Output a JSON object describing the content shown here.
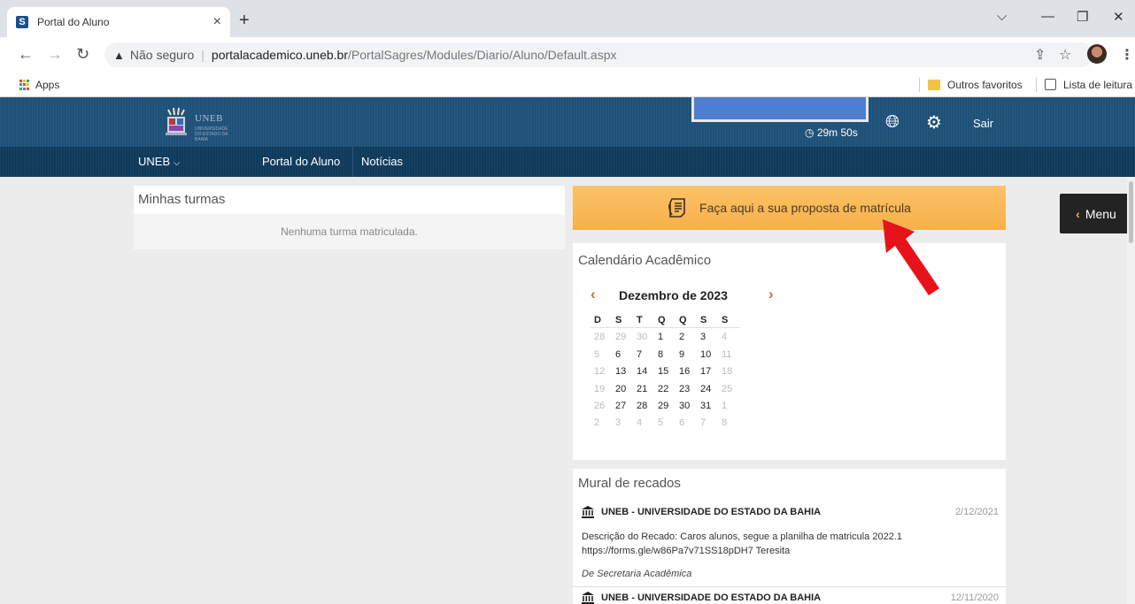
{
  "browser": {
    "tab_title": "Portal do Aluno",
    "tab_favicon_letter": "S",
    "tab_close": "×",
    "new_tab": "+",
    "url_insecure_label": "Não seguro",
    "url_host": "portalacademico.uneb.br",
    "url_path": "/PortalSagres/Modules/Diario/Aluno/Default.aspx",
    "bookmarks": {
      "apps": "Apps",
      "other": "Outros favoritos",
      "reading_list": "Lista de leitura"
    }
  },
  "header": {
    "logo_text": "UNEB",
    "logo_subtext": "UNIVERSIDADE DO ESTADO DA BAHIA",
    "timer": "29m 50s",
    "logout": "Sair"
  },
  "nav": {
    "uneb": "UNEB",
    "portal": "Portal do Aluno",
    "news": "Notícias"
  },
  "turmas": {
    "title": "Minhas turmas",
    "empty": "Nenhuma turma matriculada."
  },
  "proposta": {
    "label": "Faça aqui a sua proposta de matrícula"
  },
  "calendar": {
    "title": "Calendário Acadêmico",
    "month": "Dezembro de 2023",
    "prev": "‹",
    "next": "›",
    "weekdays": [
      "D",
      "S",
      "T",
      "Q",
      "Q",
      "S",
      "S"
    ],
    "weeks": [
      [
        {
          "d": "28",
          "m": "out"
        },
        {
          "d": "29",
          "m": "out"
        },
        {
          "d": "30",
          "m": "out"
        },
        {
          "d": "1",
          "m": "in"
        },
        {
          "d": "2",
          "m": "in"
        },
        {
          "d": "3",
          "m": "in"
        },
        {
          "d": "4",
          "m": "we"
        }
      ],
      [
        {
          "d": "5",
          "m": "we"
        },
        {
          "d": "6",
          "m": "in"
        },
        {
          "d": "7",
          "m": "in"
        },
        {
          "d": "8",
          "m": "in"
        },
        {
          "d": "9",
          "m": "in"
        },
        {
          "d": "10",
          "m": "in"
        },
        {
          "d": "11",
          "m": "we"
        }
      ],
      [
        {
          "d": "12",
          "m": "we"
        },
        {
          "d": "13",
          "m": "in"
        },
        {
          "d": "14",
          "m": "in"
        },
        {
          "d": "15",
          "m": "in"
        },
        {
          "d": "16",
          "m": "in"
        },
        {
          "d": "17",
          "m": "in"
        },
        {
          "d": "18",
          "m": "we"
        }
      ],
      [
        {
          "d": "19",
          "m": "we"
        },
        {
          "d": "20",
          "m": "in"
        },
        {
          "d": "21",
          "m": "in"
        },
        {
          "d": "22",
          "m": "in"
        },
        {
          "d": "23",
          "m": "in"
        },
        {
          "d": "24",
          "m": "in"
        },
        {
          "d": "25",
          "m": "we"
        }
      ],
      [
        {
          "d": "26",
          "m": "we"
        },
        {
          "d": "27",
          "m": "in"
        },
        {
          "d": "28",
          "m": "in"
        },
        {
          "d": "29",
          "m": "in"
        },
        {
          "d": "30",
          "m": "in"
        },
        {
          "d": "31",
          "m": "in"
        },
        {
          "d": "1",
          "m": "out"
        }
      ],
      [
        {
          "d": "2",
          "m": "out"
        },
        {
          "d": "3",
          "m": "out"
        },
        {
          "d": "4",
          "m": "out"
        },
        {
          "d": "5",
          "m": "out"
        },
        {
          "d": "6",
          "m": "out"
        },
        {
          "d": "7",
          "m": "out"
        },
        {
          "d": "8",
          "m": "out"
        }
      ]
    ]
  },
  "mural": {
    "title": "Mural de recados",
    "messages": [
      {
        "sender": "UNEB - UNIVERSIDADE DO ESTADO DA BAHIA",
        "date": "2/12/2021",
        "body_line1": "Descrição do Recado: Caros alunos, segue a planilha de matricula 2022.1",
        "body_line2": "https://forms.gle/w86Pa7v71SS18pDH7 Teresita",
        "from": "De Secretaria Acadêmica"
      },
      {
        "sender": "UNEB - UNIVERSIDADE DO ESTADO DA BAHIA",
        "date": "12/11/2020"
      }
    ]
  },
  "menu": {
    "label": "Menu"
  },
  "colors": {
    "header_bg": "#1e5178",
    "nav_bg": "#0f3a5b",
    "proposta_bg": "#f9b54f",
    "calendar_arrow": "#d16a2a",
    "annotation_arrow": "#e8121a"
  }
}
